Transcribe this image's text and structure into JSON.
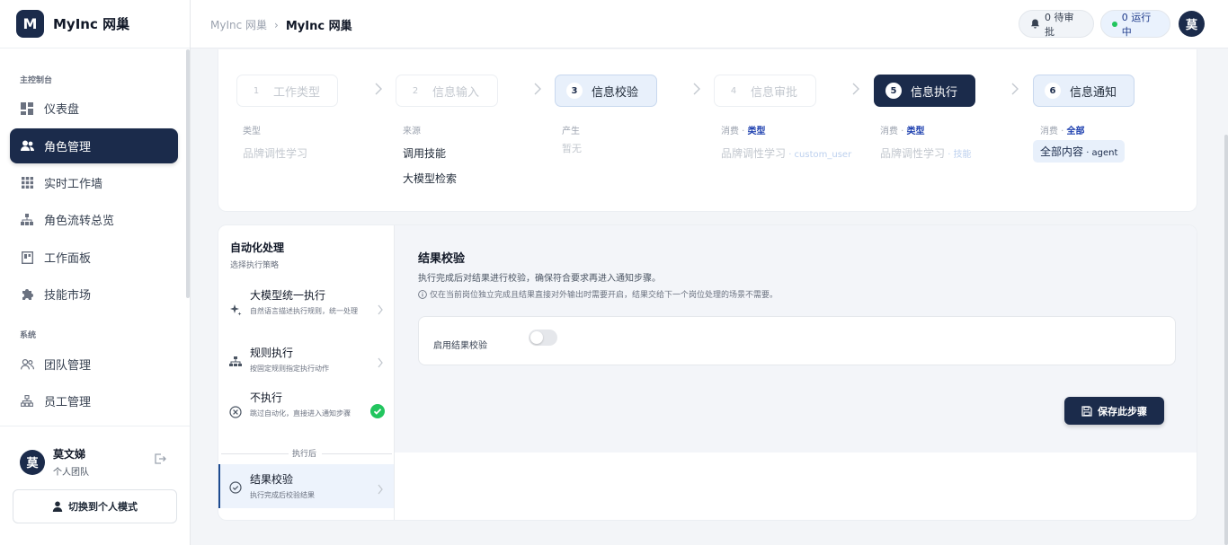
{
  "brand": {
    "logo_letter": "M",
    "name": "MyInc 网巢"
  },
  "sidebar": {
    "section_main": "主控制台",
    "section_system": "系统",
    "items": [
      {
        "label": "仪表盘",
        "icon": "dashboard-icon"
      },
      {
        "label": "角色管理",
        "icon": "users-icon",
        "active": true
      },
      {
        "label": "实时工作墙",
        "icon": "grid-icon"
      },
      {
        "label": "角色流转总览",
        "icon": "hierarchy-icon"
      },
      {
        "label": "工作面板",
        "icon": "panel-icon"
      },
      {
        "label": "技能市场",
        "icon": "puzzle-icon"
      }
    ],
    "system_items": [
      {
        "label": "团队管理",
        "icon": "team-icon"
      },
      {
        "label": "员工管理",
        "icon": "org-icon"
      }
    ],
    "user": {
      "avatar": "莫",
      "name": "莫文娣",
      "team": "个人团队"
    },
    "switch_label": "切换到个人模式"
  },
  "header": {
    "breadcrumb": [
      "MyInc 网巢",
      "MyInc 网巢"
    ],
    "pending_label": "0 待审批",
    "running_label": "0 运行中",
    "avatar": "莫"
  },
  "steps": [
    {
      "num": "1",
      "label": "工作类型",
      "meta_prefix": "类型",
      "meta_highlight": "",
      "value": "品牌调性学习"
    },
    {
      "num": "2",
      "label": "信息输入",
      "meta_prefix": "来源",
      "meta_highlight": "",
      "values": [
        "调用技能",
        "大模型检索"
      ]
    },
    {
      "num": "3",
      "label": "信息校验",
      "meta_prefix": "产生",
      "meta_highlight": "",
      "value": "暂无"
    },
    {
      "num": "4",
      "label": "信息审批",
      "meta_prefix": "消费 · ",
      "meta_highlight": "类型",
      "value": "品牌调性学习",
      "code": " · custom_user"
    },
    {
      "num": "5",
      "label": "信息执行",
      "meta_prefix": "消费 · ",
      "meta_highlight": "类型",
      "value": "品牌调性学习",
      "code": " · 技能"
    },
    {
      "num": "6",
      "label": "信息通知",
      "meta_prefix": "消费 · ",
      "meta_highlight": "全部",
      "value": "全部内容",
      "code": " · agent"
    }
  ],
  "automation": {
    "title": "自动化处理",
    "subtitle": "选择执行策略",
    "options": [
      {
        "title": "大模型统一执行",
        "desc": "自然语言描述执行规则，统一处理",
        "icon": "sparkle-icon"
      },
      {
        "title": "规则执行",
        "desc": "按固定规则指定执行动作",
        "icon": "hierarchy-icon"
      },
      {
        "title": "不执行",
        "desc": "跳过自动化，直接进入通知步骤",
        "icon": "cancel-circle-icon",
        "selected": true
      }
    ],
    "after_label": "执行后",
    "post_option": {
      "title": "结果校验",
      "desc": "执行完成后校验结果",
      "icon": "check-circle-icon"
    }
  },
  "detail": {
    "title": "结果校验",
    "desc": "执行完成后对结果进行校验，确保符合要求再进入通知步骤。",
    "note": "仅在当前岗位独立完成且结果直接对外输出时需要开启，结果交给下一个岗位处理的场景不需要。",
    "toggle_label": "启用结果校验",
    "toggle_on": false,
    "save_label": "保存此步骤"
  }
}
